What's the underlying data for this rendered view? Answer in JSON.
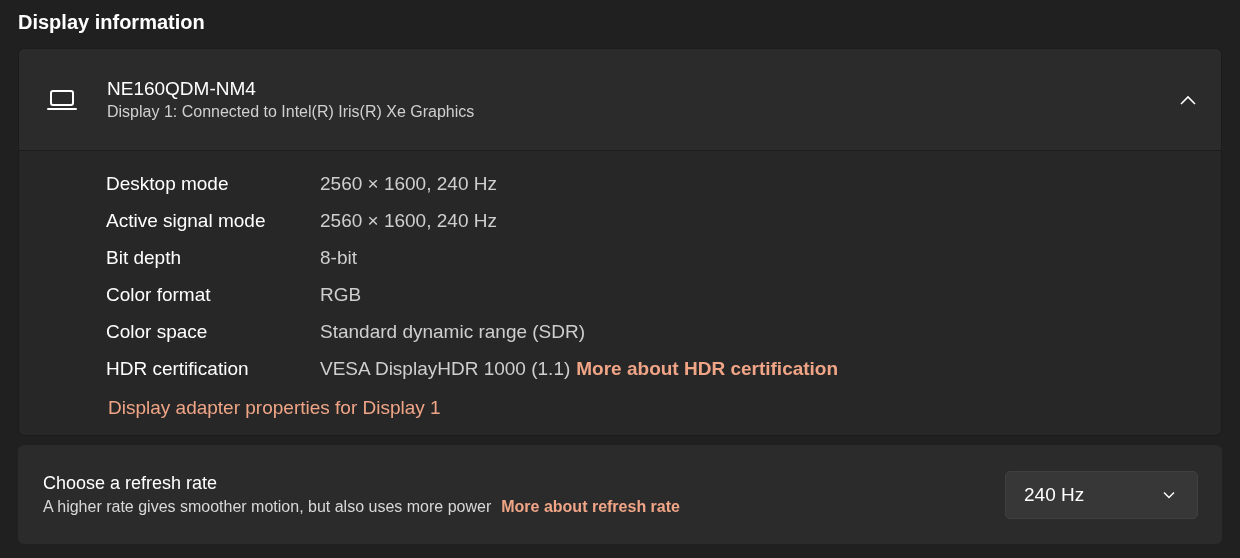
{
  "title": "Display information",
  "display": {
    "name": "NE160QDM-NM4",
    "subtitle": "Display 1: Connected to Intel(R) Iris(R) Xe Graphics",
    "expanded": true,
    "details": [
      {
        "label": "Desktop mode",
        "value": "2560 × 1600, 240 Hz"
      },
      {
        "label": "Active signal mode",
        "value": "2560 × 1600, 240 Hz"
      },
      {
        "label": "Bit depth",
        "value": "8-bit"
      },
      {
        "label": "Color format",
        "value": "RGB"
      },
      {
        "label": "Color space",
        "value": "Standard dynamic range (SDR)"
      },
      {
        "label": "HDR certification",
        "value": "VESA DisplayHDR 1000 (1.1)",
        "link": "More about HDR certification"
      }
    ],
    "adapter_link": "Display adapter properties for Display 1"
  },
  "refresh": {
    "title": "Choose a refresh rate",
    "description": "A higher rate gives smoother motion, but also uses more power",
    "link": "More about refresh rate",
    "dropdown_value": "240 Hz"
  }
}
